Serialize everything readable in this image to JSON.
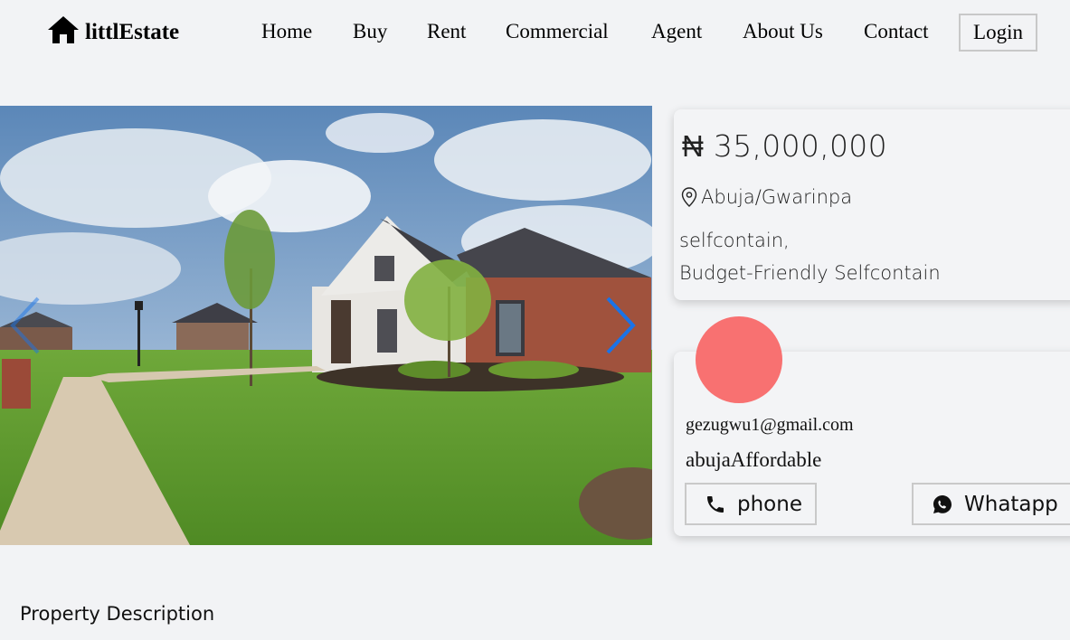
{
  "nav": {
    "logo_text": "littlEstate",
    "links": [
      "Home",
      "Buy",
      "Rent",
      "Commercial",
      "Agent",
      "About Us",
      "Contact"
    ],
    "login_label": "Login"
  },
  "gallery": {
    "prev_icon": "chevron-left-icon",
    "next_icon": "chevron-right-icon"
  },
  "listing": {
    "price": "₦ 35,000,000",
    "location": "Abuja/Gwarinpa",
    "type": "selfcontain,",
    "title": "Budget-Friendly Selfcontain"
  },
  "agent": {
    "email": "gezugwu1@gmail.com",
    "name": "abujaAffordable",
    "phone_label": "phone",
    "whatsapp_label": "Whatapp"
  },
  "section": {
    "description_heading": "Property Description"
  },
  "colors": {
    "background": "#f2f3f5",
    "avatar": "#f87171",
    "arrow": "#1a73e8"
  }
}
